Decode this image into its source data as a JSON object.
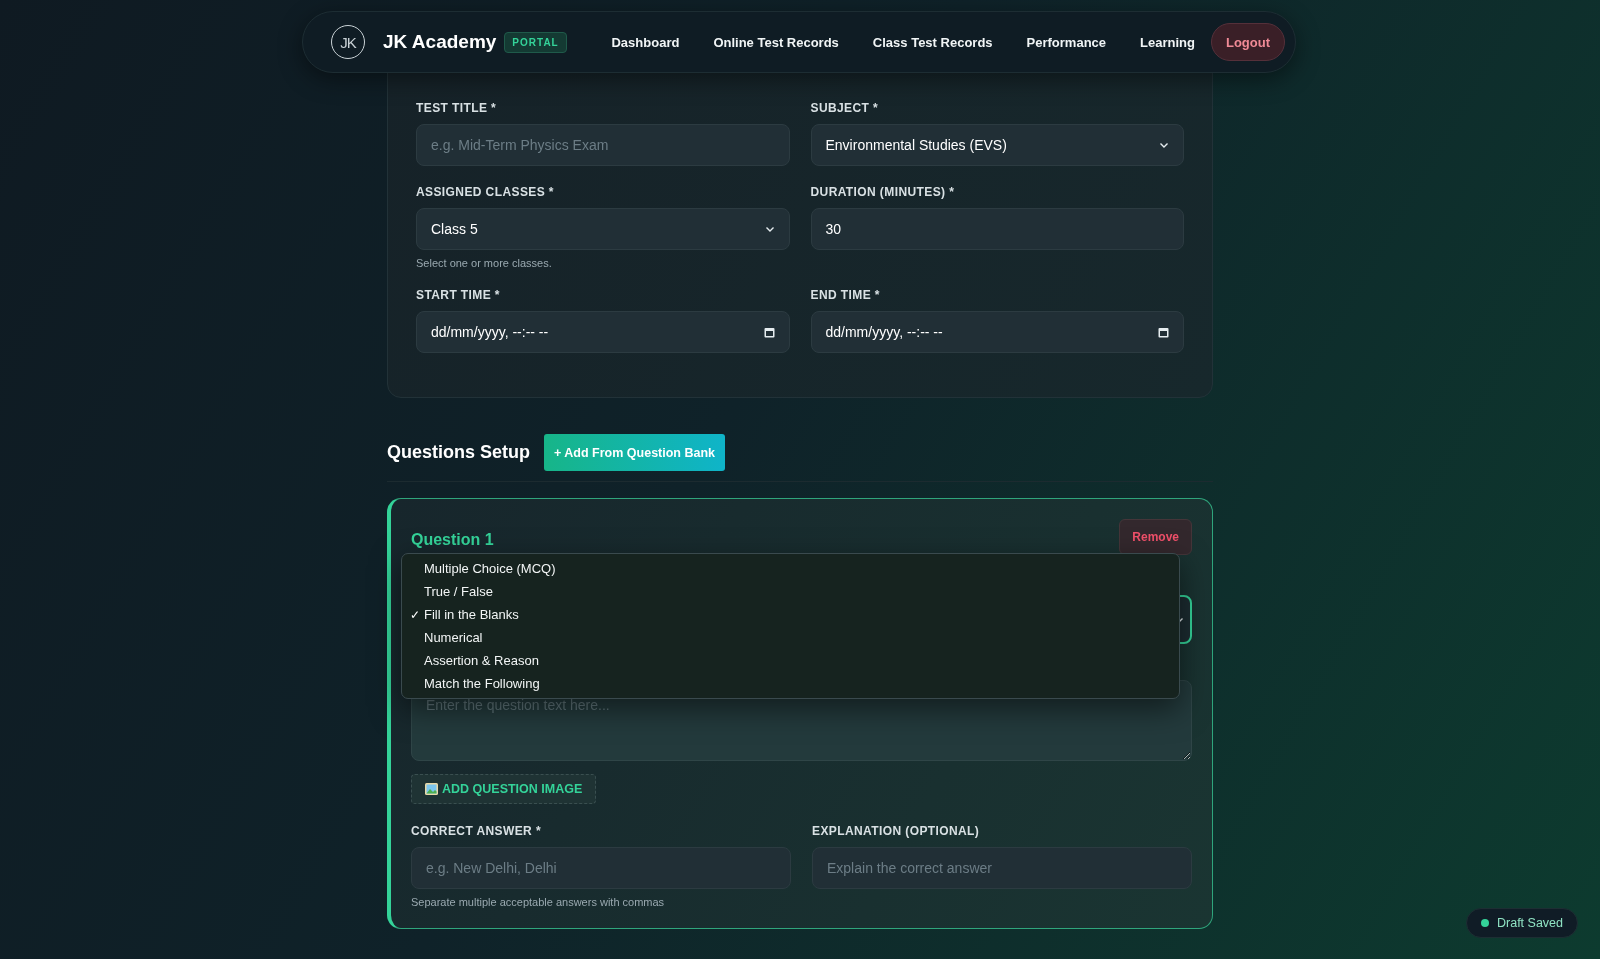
{
  "nav": {
    "logo_text": "JK",
    "brand": "JK Academy",
    "badge": "PORTAL",
    "links": [
      "Dashboard",
      "Online Test Records",
      "Class Test Records",
      "Performance",
      "Learning"
    ],
    "logout": "Logout"
  },
  "test_form": {
    "fields": [
      {
        "label": "TEST TITLE *",
        "kind": "text",
        "placeholder": "e.g. Mid-Term Physics Exam"
      },
      {
        "label": "SUBJECT *",
        "kind": "select",
        "value": "Environmental Studies (EVS)"
      },
      {
        "label": "ASSIGNED CLASSES *",
        "kind": "select",
        "value": "Class 5",
        "help": "Select one or more classes."
      },
      {
        "label": "DURATION (MINUTES) *",
        "kind": "text",
        "value": "30"
      },
      {
        "label": "START TIME *",
        "kind": "datetime",
        "value": "dd/mm/yyyy, --:-- --"
      },
      {
        "label": "END TIME *",
        "kind": "datetime",
        "value": "dd/mm/yyyy, --:-- --"
      }
    ]
  },
  "questions_setup": {
    "title": "Questions Setup",
    "add_button": "+ Add From Question Bank"
  },
  "question": {
    "title": "Question 1",
    "remove": "Remove",
    "type_menu": [
      {
        "label": "Multiple Choice (MCQ)",
        "selected": false
      },
      {
        "label": "True / False",
        "selected": false
      },
      {
        "label": "Fill in the Blanks",
        "selected": true
      },
      {
        "label": "Numerical",
        "selected": false
      },
      {
        "label": "Assertion & Reason",
        "selected": false
      },
      {
        "label": "Match the Following",
        "selected": false
      }
    ],
    "check_mark": "✓",
    "text_placeholder": "Enter the question text here...",
    "add_image": "ADD QUESTION IMAGE",
    "fields": [
      {
        "label": "CORRECT ANSWER *",
        "placeholder": "e.g. New Delhi, Delhi",
        "help": "Separate multiple acceptable answers with commas"
      },
      {
        "label": "EXPLANATION (OPTIONAL)",
        "placeholder": "Explain the correct answer"
      }
    ]
  },
  "status": {
    "text": "Draft Saved"
  }
}
